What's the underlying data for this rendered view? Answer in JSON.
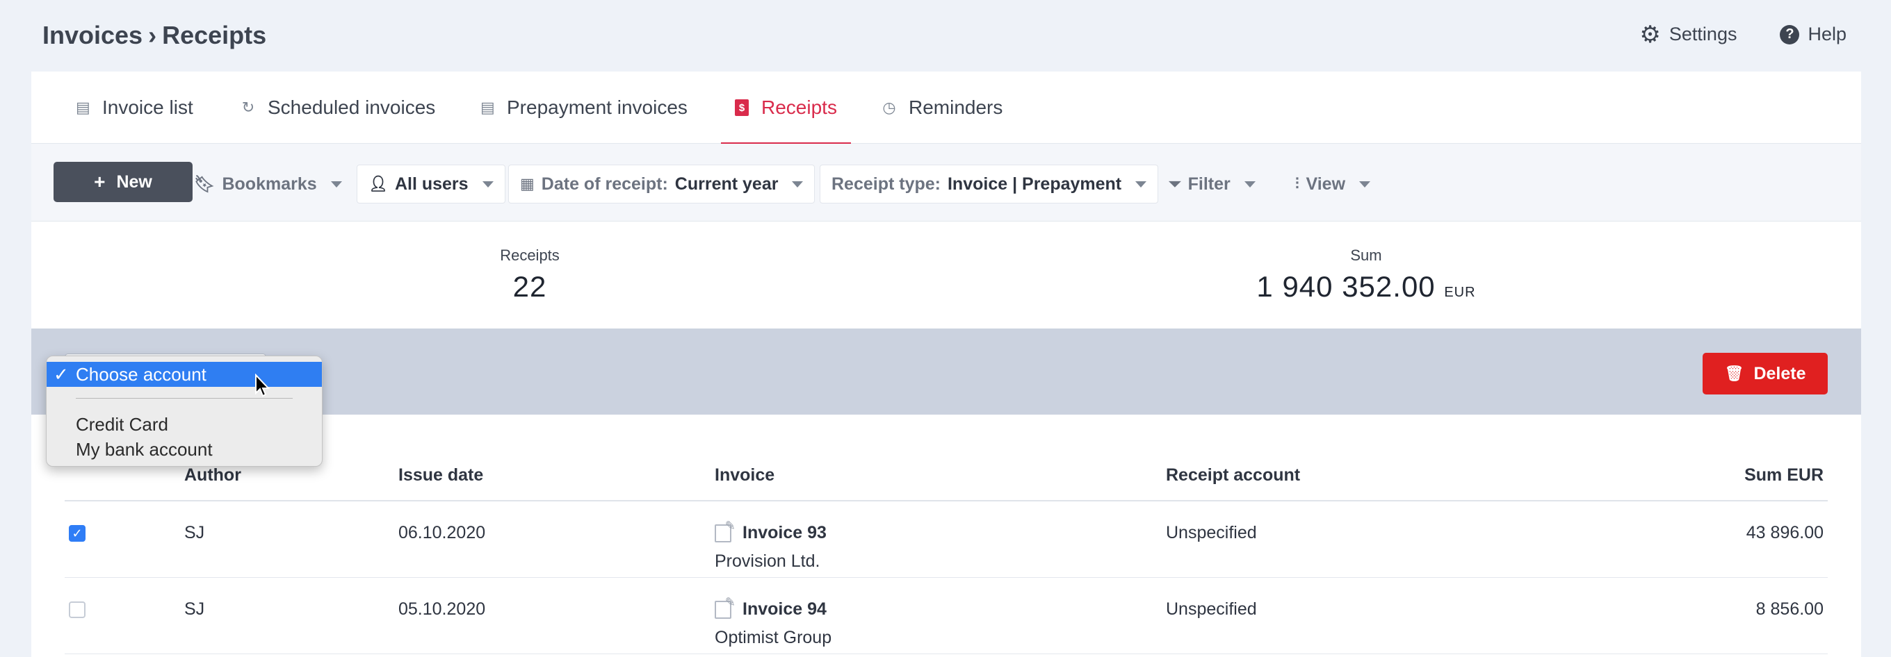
{
  "breadcrumb": {
    "section": "Invoices",
    "separator": "›",
    "page": "Receipts"
  },
  "top_actions": {
    "settings": "Settings",
    "help": "Help",
    "help_glyph": "?"
  },
  "tabs": [
    {
      "label": "Invoice list",
      "icon": "invoice-list-icon",
      "active": false
    },
    {
      "label": "Scheduled invoices",
      "icon": "refresh-icon",
      "active": false
    },
    {
      "label": "Prepayment invoices",
      "icon": "invoice-list-icon",
      "active": false
    },
    {
      "label": "Receipts",
      "icon": "receipt-icon",
      "active": true,
      "glyph": "$"
    },
    {
      "label": "Reminders",
      "icon": "clock-icon",
      "active": false
    }
  ],
  "toolbar": {
    "new_label": "New",
    "bookmarks_label": "Bookmarks",
    "users_label": "All users",
    "date_label": "Date of receipt:",
    "date_value": "Current year",
    "type_label": "Receipt type:",
    "type_value": "Invoice | Prepayment",
    "filter_label": "Filter",
    "view_label": "View"
  },
  "stats": {
    "receipts_label": "Receipts",
    "receipts_value": "22",
    "sum_label": "Sum",
    "sum_value": "1 940 352.00",
    "sum_unit": "EUR"
  },
  "actionbar": {
    "delete_label": "Delete",
    "account_select": {
      "selected": "Choose account",
      "options": [
        "Credit Card",
        "My bank account"
      ]
    }
  },
  "table": {
    "headers": {
      "author": "Author",
      "issue_date": "Issue date",
      "invoice": "Invoice",
      "receipt_account": "Receipt account",
      "sum": "Sum EUR"
    },
    "rows": [
      {
        "checked": true,
        "author": "SJ",
        "issue_date": "06.10.2020",
        "invoice": "Invoice 93",
        "client": "Provision Ltd.",
        "receipt_account": "Unspecified",
        "sum": "43 896.00"
      },
      {
        "checked": false,
        "author": "SJ",
        "issue_date": "05.10.2020",
        "invoice": "Invoice 94",
        "client": "Optimist Group",
        "receipt_account": "Unspecified",
        "sum": "8 856.00"
      }
    ]
  },
  "colors": {
    "accent": "#d92b4b",
    "delete": "#e02020",
    "select_highlight": "#2f7ef2",
    "checkbox": "#2f7df6"
  }
}
